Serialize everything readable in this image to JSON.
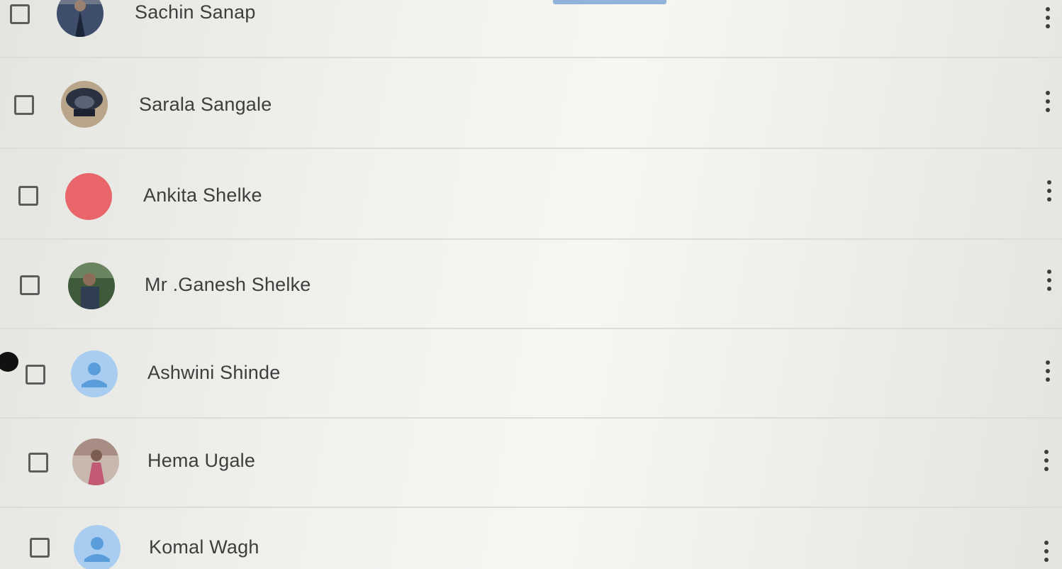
{
  "contacts": [
    {
      "name": "Sachin Sanap",
      "avatar": "photo-avatar"
    },
    {
      "name": "Sarala Sangale",
      "avatar": "photo-avatar"
    },
    {
      "name": "Ankita Shelke",
      "avatar": "color-avatar",
      "avatar_color": "#e8666a"
    },
    {
      "name": "Mr .Ganesh Shelke",
      "avatar": "photo-avatar"
    },
    {
      "name": "Ashwini Shinde",
      "avatar": "default-person-avatar",
      "avatar_color": "#a9cdf0"
    },
    {
      "name": "Hema Ugale",
      "avatar": "photo-avatar"
    },
    {
      "name": "Komal Wagh",
      "avatar": "default-person-avatar",
      "avatar_color": "#a9cdf0"
    }
  ],
  "icons": {
    "checkbox": "checkbox-unchecked-icon",
    "menu": "more-vert-icon"
  },
  "colors": {
    "accent": "#8fb3d9",
    "text": "#3e3e3e"
  }
}
